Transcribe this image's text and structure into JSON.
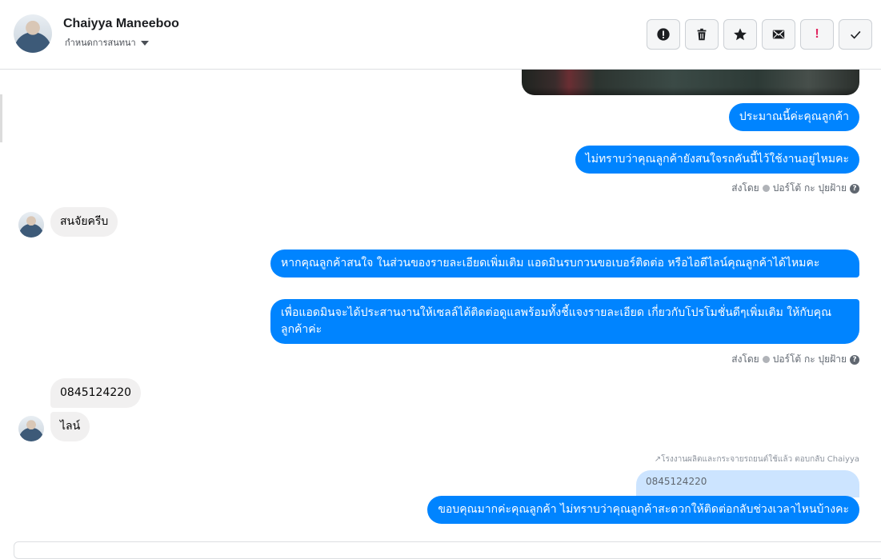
{
  "header": {
    "contact_name": "Chaiyya Maneeboo",
    "assign_label": "กำหนดการสนทนา",
    "toolbar": [
      {
        "icon": "alert-circle-icon",
        "label": ""
      },
      {
        "icon": "trash-icon",
        "label": ""
      },
      {
        "icon": "star-icon",
        "label": ""
      },
      {
        "icon": "envelope-icon",
        "label": ""
      },
      {
        "icon": "exclamation-icon",
        "label": "!"
      },
      {
        "icon": "check-icon",
        "label": ""
      }
    ]
  },
  "messages": {
    "out_1": "ประมาณนี้ค่ะคุณลูกค้า",
    "out_2": "ไม่ทราบว่าคุณลูกค้ายังสนใจรถคันนี้ไว้ใช้งานอยู่ไหมคะ",
    "sent_by_1": "ส่งโดย",
    "sender_1": "ปอร์โต้ กะ ปุยฝ้าย",
    "in_1": "สนจัยครีบ",
    "out_3": "หากคุณลูกค้าสนใจ ในส่วนของรายละเอียดเพิ่มเติม แอดมินรบกวนขอเบอร์ติดต่อ หรือไอดีไลน์คุณลูกค้าได้ไหมคะ",
    "out_4": "เพื่อแอดมินจะได้ประสานงานให้เซลล์ได้ติดต่อดูแลพร้อมทั้งชี้แจงรายละเอียด เกี่ยวกับโปรโมชั่นดีๆเพิ่มเติม ให้กับคุณลูกค้าค่ะ",
    "sent_by_2": "ส่งโดย",
    "sender_2": "ปอร์โต้ กะ ปุยฝ้าย",
    "in_2": "0845124220",
    "in_3": "ไลน์",
    "reply_context": "↗โรงงานผลิตและกระจายรถยนต์ใช้แล้ว ตอบกลับ Chaiyya",
    "reply_quote": "0845124220",
    "out_5": "ขอบคุณมากค่ะคุณลูกค้า ไม่ทราบว่าคุณลูกค้าสะดวกให้ติดต่อกลับช่วงเวลาไหนบ้างคะ"
  },
  "colors": {
    "outgoing_bubble": "#0084ff",
    "incoming_bubble": "#f1f0f0",
    "reply_quote_bg": "#cce4ff"
  }
}
